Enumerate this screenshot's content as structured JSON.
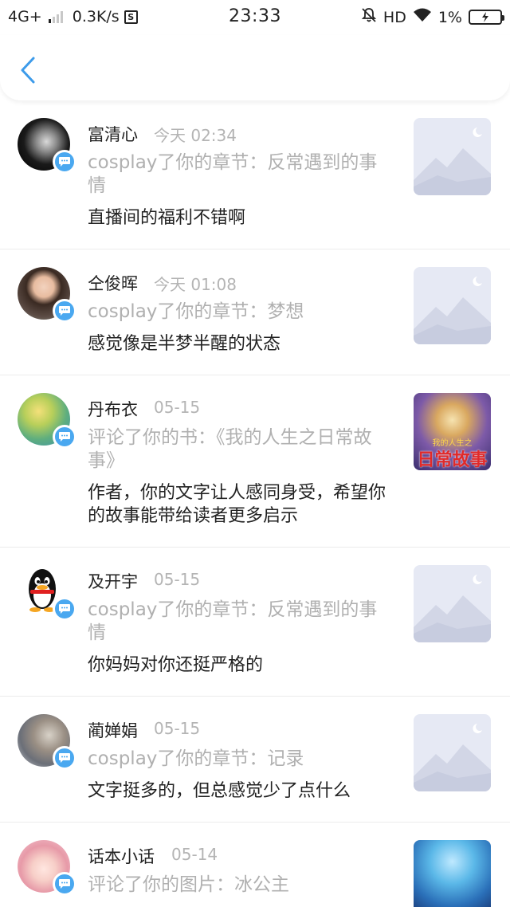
{
  "status_bar": {
    "network": "4G+",
    "speed": "0.3K/s",
    "time": "23:33",
    "hd": "HD",
    "battery": "1%"
  },
  "nav": {
    "back_icon": "chevron-left-icon"
  },
  "colors": {
    "accent": "#3d9bea",
    "badge": "#4aa8f0",
    "placeholder_bg": "#e6e9f4"
  },
  "items": [
    {
      "name": "富清心",
      "time": "今天 02:34",
      "action": "cosplay了你的章节：反常遇到的事情",
      "comment": "直播间的福利不错啊",
      "thumb": "placeholder-icon"
    },
    {
      "name": "仝俊晖",
      "time": "今天 01:08",
      "action": "cosplay了你的章节：梦想",
      "comment": "感觉像是半梦半醒的状态",
      "thumb": "placeholder-icon"
    },
    {
      "name": "丹布衣",
      "time": "05-15",
      "action": "评论了你的书：《我的人生之日常故事》",
      "comment": "作者，你的文字让人感同身受，希望你的故事能带给读者更多启示",
      "thumb": "book-cover",
      "cover_title": "日常故事",
      "cover_small": "我的人生之"
    },
    {
      "name": "及开宇",
      "time": "05-15",
      "action": "cosplay了你的章节：反常遇到的事情",
      "comment": "你妈妈对你还挺严格的",
      "thumb": "placeholder-icon"
    },
    {
      "name": "蔺婵娟",
      "time": "05-15",
      "action": "cosplay了你的章节：记录",
      "comment": "文字挺多的，但总感觉少了点什么",
      "thumb": "placeholder-icon"
    },
    {
      "name": "话本小话",
      "time": "05-14",
      "action": "评论了你的图片：冰公主",
      "comment": "",
      "thumb": "image-thumbnail"
    }
  ]
}
